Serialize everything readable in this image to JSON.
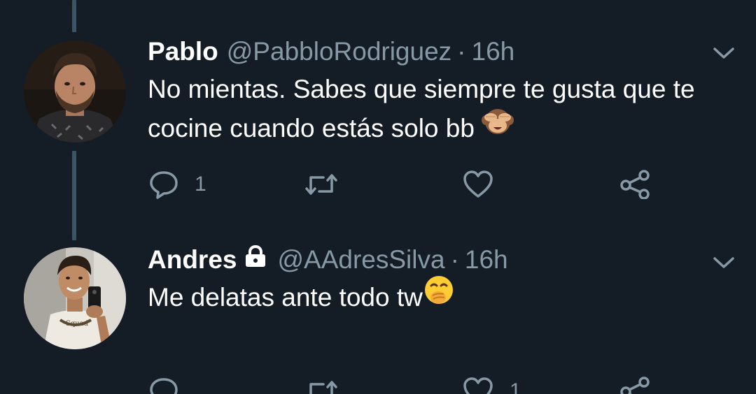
{
  "colors": {
    "background": "#141d26",
    "text": "#ffffff",
    "secondary": "#8899a6",
    "thread_line": "#3d5466"
  },
  "tweets": [
    {
      "name": "Pablo",
      "handle": "@PabbloRodriguez",
      "separator": "·",
      "time": "16h",
      "protected": false,
      "text": "No mientas. Sabes que siempre te gusta que te cocine cuando estás solo bb",
      "emoji": "see-no-evil-monkey",
      "reply_count": "1",
      "retweet_count": "",
      "like_count": ""
    },
    {
      "name": "Andres",
      "handle": "@AAdresSilva",
      "separator": "·",
      "time": "16h",
      "protected": true,
      "text": "Me delatas ante todo tw",
      "emoji": "hand-over-mouth",
      "reply_count": "",
      "retweet_count": "",
      "like_count": "1"
    }
  ],
  "icons": {
    "reply": "reply-icon",
    "retweet": "retweet-icon",
    "like": "heart-icon",
    "share": "share-icon",
    "menu": "chevron-down-icon",
    "protected": "lock-icon"
  }
}
